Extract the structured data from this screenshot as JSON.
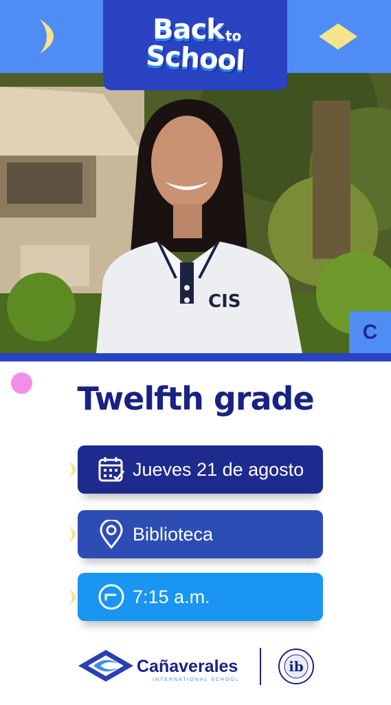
{
  "header": {
    "title_line1": "Back",
    "title_to": "to",
    "title_line2": "School",
    "decor_left": "crescent-moon-icon",
    "decor_right": "diamond-icon"
  },
  "photo": {
    "shirt_text": "CIS",
    "section_letter": "C"
  },
  "event": {
    "grade": "Twelfth grade",
    "date": "Jueves 21 de agosto",
    "place": "Biblioteca",
    "time": "7:15 a.m."
  },
  "footer": {
    "brand_name": "Cañaverales",
    "brand_sub": "INTERNATIONAL SCHOOL",
    "ib_text": "ib"
  },
  "colors": {
    "header_blue": "#4f8df5",
    "title_box": "#2a43c2",
    "heading": "#1a2185",
    "date_row": "#1f2a8e",
    "place_row": "#2d4db5",
    "time_row": "#1a96f2",
    "accent_yellow": "#f6e48a",
    "pink": "#f38ee6"
  }
}
